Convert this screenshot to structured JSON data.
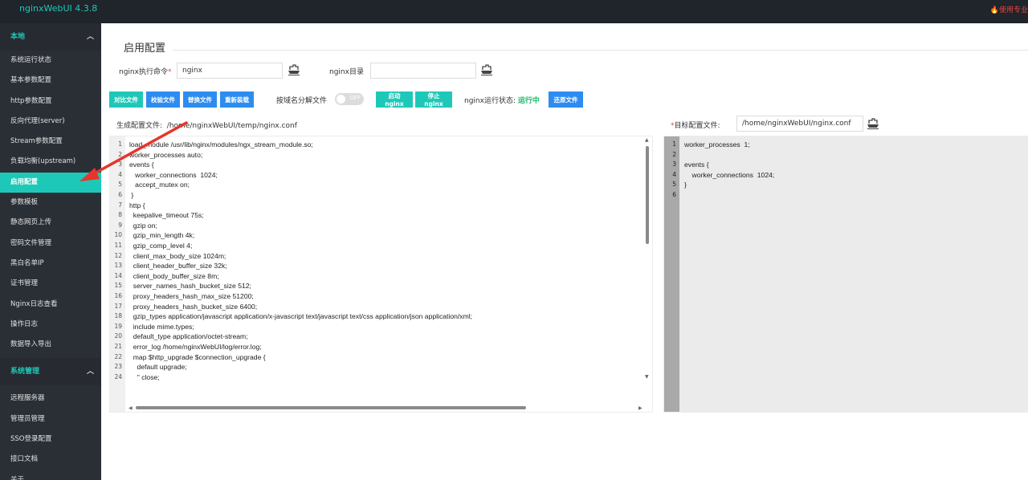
{
  "app": {
    "title": "nginxWebUI 4.3.8",
    "pro_badge": "使用专业",
    "accent": "#1ec8b8",
    "annotation_arrow_color": "#e5352c"
  },
  "sidebar": {
    "group1": {
      "title": "本地",
      "items": [
        "系统运行状态",
        "基本参数配置",
        "http参数配置",
        "反向代理(server)",
        "Stream参数配置",
        "负载均衡(upstream)",
        "启用配置",
        "参数模板",
        "静态网页上传",
        "密码文件管理",
        "黑白名单IP",
        "证书管理",
        "Nginx日志查看",
        "操作日志",
        "数据导入导出"
      ],
      "active_index": 6
    },
    "group2": {
      "title": "系统管理",
      "items": [
        "远程服务器",
        "管理员管理",
        "SSO登录配置",
        "接口文档",
        "关于"
      ]
    }
  },
  "main": {
    "page_title": "启用配置",
    "nginx_cmd": {
      "label": "nginx执行命令",
      "required_mark": "*",
      "value": "nginx"
    },
    "nginx_dir": {
      "label": "nginx目录",
      "value": ""
    },
    "buttons": {
      "compare": "对比文件",
      "verify": "校验文件",
      "replace": "替换文件",
      "reload": "重新装载",
      "start": "启动nginx",
      "stop": "停止nginx",
      "restore": "还原文件"
    },
    "split_by_domain": {
      "label": "按域名分解文件",
      "toggle_text": "OFF",
      "enabled": false
    },
    "nginx_status": {
      "label": "nginx运行状态:",
      "value": "运行中",
      "color": "#19be6b"
    },
    "generated": {
      "label": "生成配置文件:",
      "path": "/home/nginxWebUI/temp/nginx.conf"
    },
    "target": {
      "required_mark": "*",
      "label": "目标配置文件:",
      "path": "/home/nginxWebUI/nginx.conf"
    }
  },
  "editor_left": {
    "lines": [
      {
        "n": "1",
        "text": "load_module /usr/lib/nginx/modules/ngx_stream_module.so;"
      },
      {
        "n": "2",
        "text": "worker_processes auto;"
      },
      {
        "n": "3",
        "text": "events {"
      },
      {
        "n": "4",
        "text": "   worker_connections  1024;"
      },
      {
        "n": "5",
        "text": "   accept_mutex on;"
      },
      {
        "n": "6",
        "text": " }"
      },
      {
        "n": "7",
        "text": "http {"
      },
      {
        "n": "8",
        "text": "  keepalive_timeout 75s;"
      },
      {
        "n": "9",
        "text": "  gzip on;"
      },
      {
        "n": "10",
        "text": "  gzip_min_length 4k;"
      },
      {
        "n": "11",
        "text": "  gzip_comp_level 4;"
      },
      {
        "n": "12",
        "text": "  client_max_body_size 1024m;"
      },
      {
        "n": "13",
        "text": "  client_header_buffer_size 32k;"
      },
      {
        "n": "14",
        "text": "  client_body_buffer_size 8m;"
      },
      {
        "n": "15",
        "text": "  server_names_hash_bucket_size 512;"
      },
      {
        "n": "16",
        "text": "  proxy_headers_hash_max_size 51200;"
      },
      {
        "n": "17",
        "text": "  proxy_headers_hash_bucket_size 6400;"
      },
      {
        "n": "18",
        "text": "  gzip_types application/javascript application/x-javascript text/javascript text/css application/json application/xml;"
      },
      {
        "n": "19",
        "text": "  include mime.types;"
      },
      {
        "n": "20",
        "text": "  default_type application/octet-stream;"
      },
      {
        "n": "21",
        "text": "  error_log /home/nginxWebUI/log/error.log;"
      },
      {
        "n": "22",
        "text": "  map $http_upgrade $connection_upgrade {"
      },
      {
        "n": "23",
        "text": "    default upgrade;"
      },
      {
        "n": "24",
        "text": "    '' close;"
      }
    ]
  },
  "editor_right": {
    "lines": [
      {
        "n": "1",
        "text": "worker_processes  1;"
      },
      {
        "n": "2",
        "text": ""
      },
      {
        "n": "3",
        "text": "events {"
      },
      {
        "n": "4",
        "text": "    worker_connections  1024;"
      },
      {
        "n": "5",
        "text": "}"
      },
      {
        "n": "6",
        "text": ""
      }
    ]
  }
}
